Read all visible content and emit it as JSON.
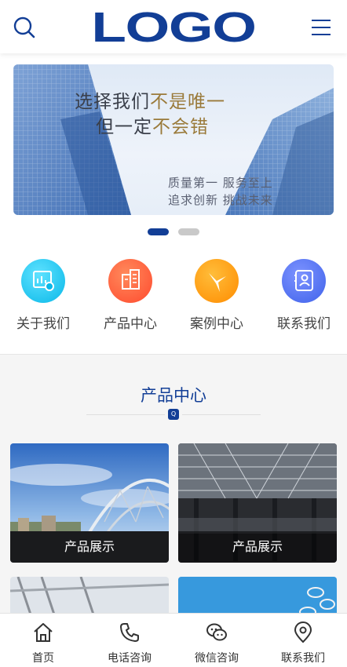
{
  "header": {
    "logo_text": "LOGO",
    "search_icon": "search-icon",
    "menu_icon": "hamburger-menu-icon"
  },
  "banner": {
    "line1_a": "选择我们",
    "line1_b": "不是唯一",
    "line2_a": "但一定",
    "line2_b": "不会错",
    "tag1": "质量第一  服务至上",
    "tag2": "追求创新  挑战未来",
    "slide_count": 2,
    "active_slide": 1
  },
  "quick_nav": [
    {
      "label": "关于我们",
      "icon": "chart-icon",
      "color": "#12c8f0"
    },
    {
      "label": "产品中心",
      "icon": "buildings-icon",
      "color": "#ff5a3c"
    },
    {
      "label": "案例中心",
      "icon": "three-way-icon",
      "color": "#ff9a0a"
    },
    {
      "label": "联系我们",
      "icon": "contact-card-icon",
      "color": "#4a6cf0"
    }
  ],
  "products_section": {
    "title": "产品中心",
    "badge": "Q",
    "items": [
      {
        "caption": "产品展示"
      },
      {
        "caption": "产品展示"
      },
      {
        "caption": ""
      },
      {
        "caption": ""
      }
    ]
  },
  "tabbar": [
    {
      "label": "首页",
      "icon": "home-icon"
    },
    {
      "label": "电话咨询",
      "icon": "phone-icon"
    },
    {
      "label": "微信咨询",
      "icon": "wechat-icon"
    },
    {
      "label": "联系我们",
      "icon": "location-pin-icon"
    }
  ],
  "colors": {
    "brand": "#123e96",
    "dot_inactive": "#c9c9c9"
  }
}
